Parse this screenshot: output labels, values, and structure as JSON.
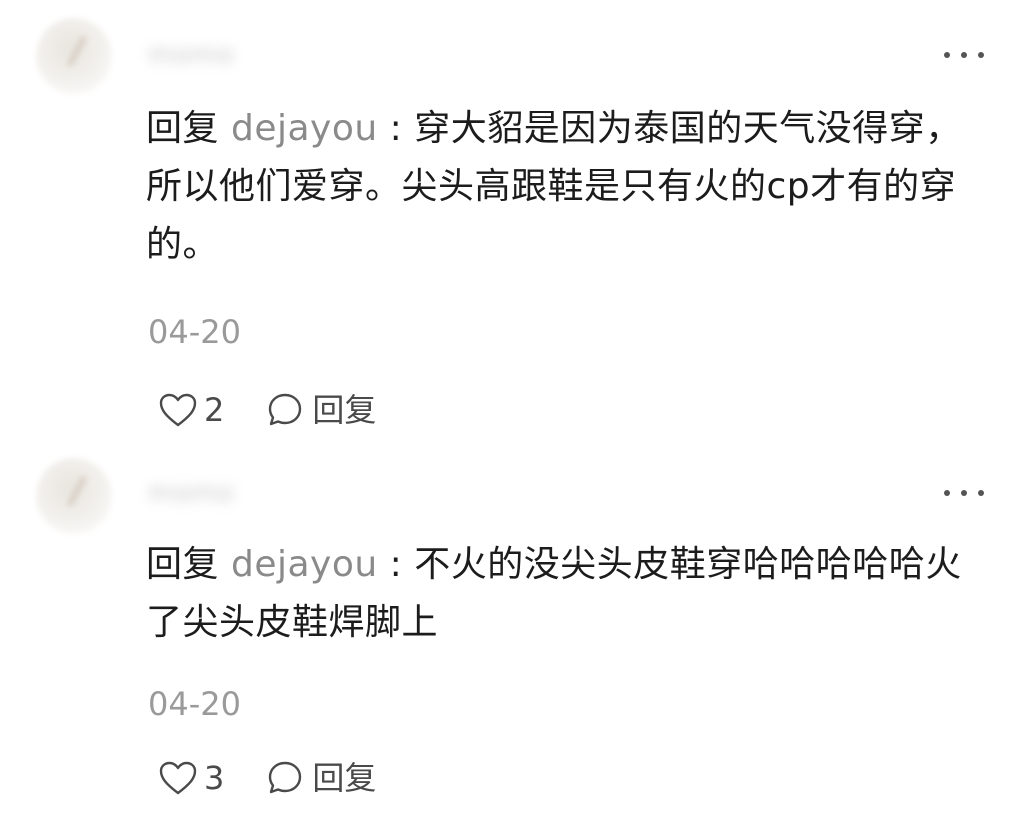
{
  "comments": [
    {
      "username": "momo",
      "reply_prefix": "回复",
      "reply_to": "dejayou",
      "separator": " : ",
      "text": "穿大貂是因为泰国的天气没得穿，所以他们爱穿。尖头高跟鞋是只有火的cp才有的穿的。",
      "date": "04-20",
      "likes": "2",
      "reply_label": "回复"
    },
    {
      "username": "momo",
      "reply_prefix": "回复",
      "reply_to": "dejayou",
      "separator": " : ",
      "text": "不火的没尖头皮鞋穿哈哈哈哈哈火了尖头皮鞋焊脚上",
      "date": "04-20",
      "likes": "3",
      "reply_label": "回复"
    }
  ]
}
